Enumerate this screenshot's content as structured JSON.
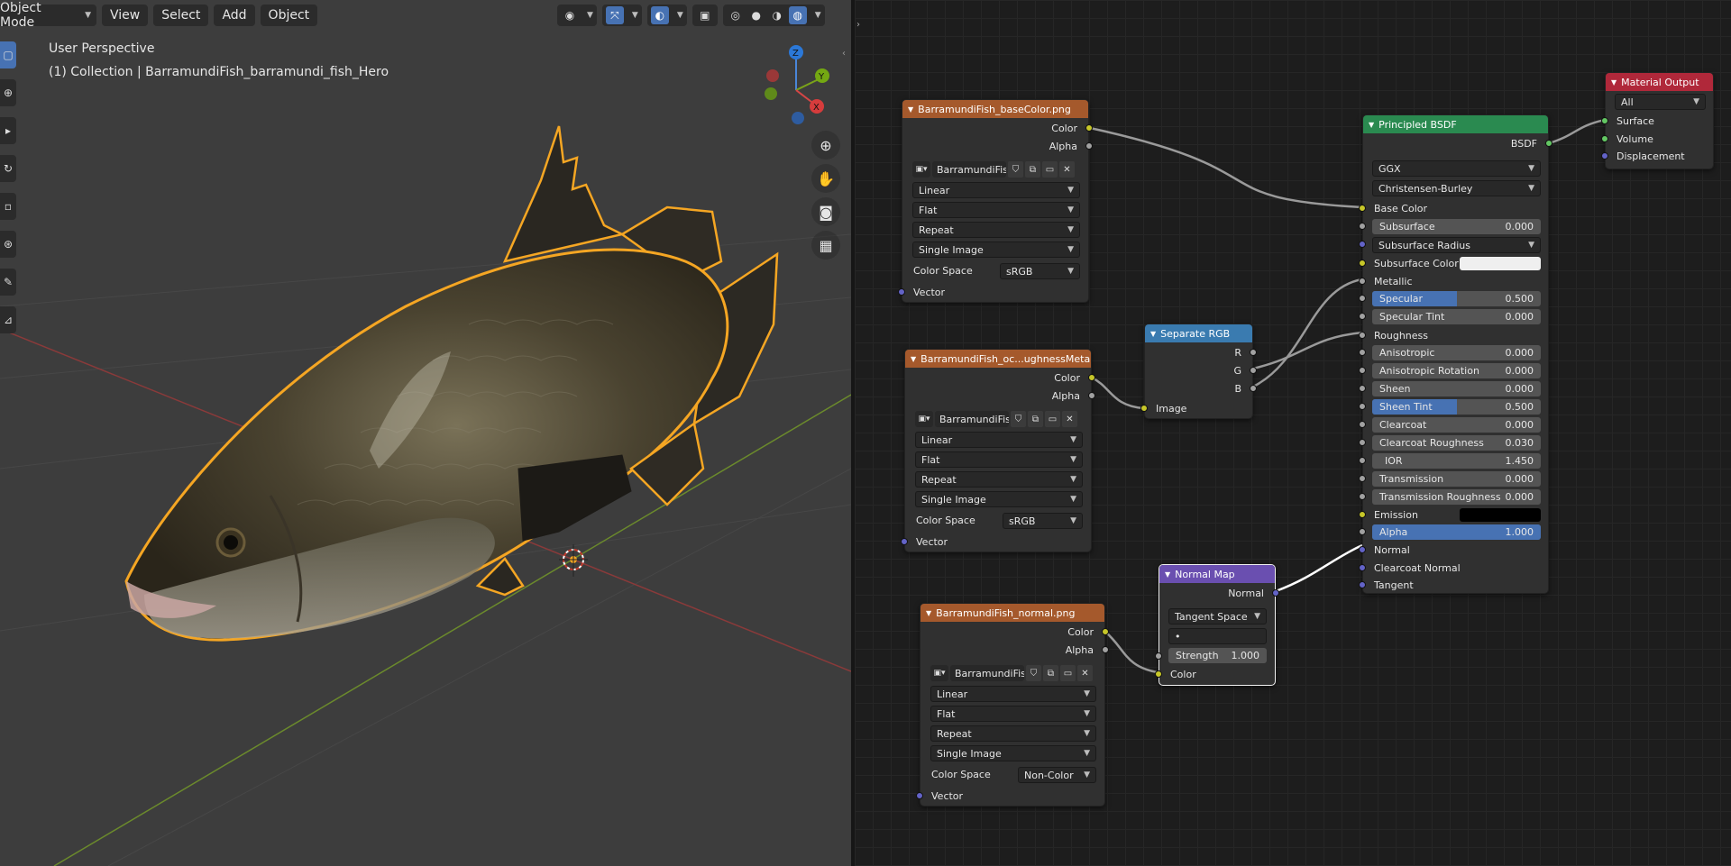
{
  "viewport": {
    "mode": "Object Mode",
    "menu": [
      "View",
      "Select",
      "Add",
      "Object"
    ],
    "perspective": "User Perspective",
    "collection_info": "(1) Collection | BarramundiFish_barramundi_fish_Hero",
    "gizmo": {
      "z": "Z",
      "y": "Y",
      "x": "X"
    },
    "icons": [
      "visibility-icon",
      "gizmo-icon",
      "overlay-icon",
      "xray-icon",
      "wireframe-icon",
      "solid-icon",
      "material-icon",
      "rendered-icon"
    ],
    "nav": [
      "zoom-icon",
      "hand-icon",
      "camera-icon",
      "grid-icon"
    ]
  },
  "nodes": {
    "base_color_tex": {
      "title": "BarramundiFish_baseColor.png",
      "outputs": [
        "Color",
        "Alpha"
      ],
      "image_name": "BarramundiFish...",
      "interpolation": "Linear",
      "projection": "Flat",
      "extension": "Repeat",
      "source": "Single Image",
      "color_space_label": "Color Space",
      "color_space": "sRGB",
      "input": "Vector"
    },
    "orm_tex": {
      "title": "BarramundiFish_oc...ughnessMetallic.png",
      "outputs": [
        "Color",
        "Alpha"
      ],
      "image_name": "BarramundiFish...",
      "interpolation": "Linear",
      "projection": "Flat",
      "extension": "Repeat",
      "source": "Single Image",
      "color_space_label": "Color Space",
      "color_space": "sRGB",
      "input": "Vector"
    },
    "normal_tex": {
      "title": "BarramundiFish_normal.png",
      "outputs": [
        "Color",
        "Alpha"
      ],
      "image_name": "BarramundiFish...",
      "interpolation": "Linear",
      "projection": "Flat",
      "extension": "Repeat",
      "source": "Single Image",
      "color_space_label": "Color Space",
      "color_space": "Non-Color",
      "input": "Vector"
    },
    "separate_rgb": {
      "title": "Separate RGB",
      "outputs": [
        "R",
        "G",
        "B"
      ],
      "input": "Image"
    },
    "normal_map": {
      "title": "Normal Map",
      "output": "Normal",
      "space": "Tangent Space",
      "uv": "•",
      "strength_label": "Strength",
      "strength": "1.000",
      "input": "Color"
    },
    "principled": {
      "title": "Principled BSDF",
      "output": "BSDF",
      "distribution": "GGX",
      "subsurface_method": "Christensen-Burley",
      "base_color": "Base Color",
      "subsurface": {
        "label": "Subsurface",
        "value": "0.000"
      },
      "subsurface_radius": "Subsurface Radius",
      "subsurface_color": "Subsurface Color",
      "metallic": "Metallic",
      "specular": {
        "label": "Specular",
        "value": "0.500",
        "fill": 0.5
      },
      "specular_tint": {
        "label": "Specular Tint",
        "value": "0.000"
      },
      "roughness": "Roughness",
      "anisotropic": {
        "label": "Anisotropic",
        "value": "0.000"
      },
      "anisotropic_rotation": {
        "label": "Anisotropic Rotation",
        "value": "0.000"
      },
      "sheen": {
        "label": "Sheen",
        "value": "0.000"
      },
      "sheen_tint": {
        "label": "Sheen Tint",
        "value": "0.500",
        "fill": 0.5
      },
      "clearcoat": {
        "label": "Clearcoat",
        "value": "0.000"
      },
      "clearcoat_roughness": {
        "label": "Clearcoat Roughness",
        "value": "0.030"
      },
      "ior": {
        "label": "IOR",
        "value": "1.450"
      },
      "transmission": {
        "label": "Transmission",
        "value": "0.000"
      },
      "transmission_roughness": {
        "label": "Transmission Roughness",
        "value": "0.000"
      },
      "emission": "Emission",
      "alpha": {
        "label": "Alpha",
        "value": "1.000",
        "fill": 1.0
      },
      "normal": "Normal",
      "clearcoat_normal": "Clearcoat Normal",
      "tangent": "Tangent"
    },
    "material_output": {
      "title": "Material Output",
      "target": "All",
      "inputs": [
        "Surface",
        "Volume",
        "Displacement"
      ]
    }
  },
  "colors": {
    "texture_header": "#a5592c",
    "shader_header": "#2a8a50",
    "converter_header": "#3a7bb0",
    "vector_header": "#6a4fb0",
    "output_header": "#b0283a",
    "selection_outline": "#f5a623",
    "accent": "#4772b3"
  }
}
